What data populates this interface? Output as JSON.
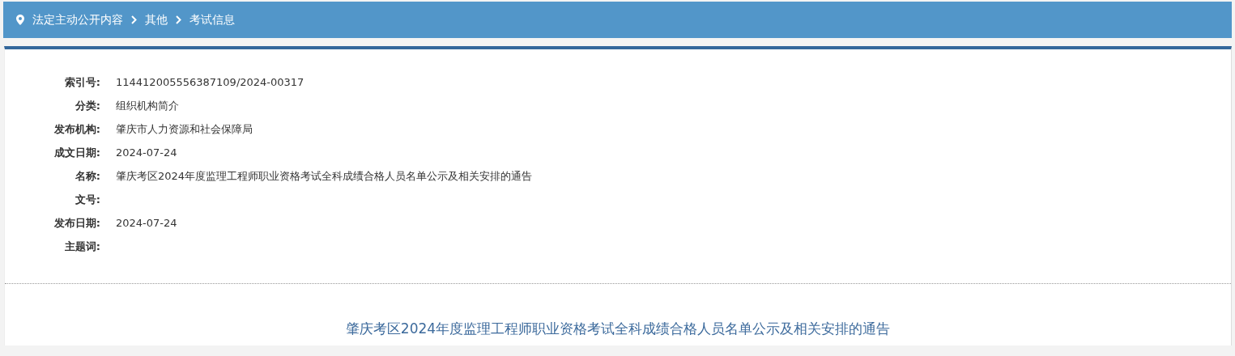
{
  "breadcrumb": [
    {
      "label": "法定主动公开内容"
    },
    {
      "label": "其他"
    },
    {
      "label": "考试信息"
    }
  ],
  "metadata": [
    {
      "label": "索引号:",
      "value": "114412005556387109/2024-00317"
    },
    {
      "label": "分类:",
      "value": "组织机构简介"
    },
    {
      "label": "发布机构:",
      "value": "肇庆市人力资源和社会保障局"
    },
    {
      "label": "成文日期:",
      "value": "2024-07-24"
    },
    {
      "label": "名称:",
      "value": "肇庆考区2024年度监理工程师职业资格考试全科成绩合格人员名单公示及相关安排的通告"
    },
    {
      "label": "文号:"
    },
    {
      "label": "发布日期:",
      "value": "2024-07-24"
    },
    {
      "label": "主题词:"
    }
  ],
  "article": {
    "title": "肇庆考区2024年度监理工程师职业资格考试全科成绩合格人员名单公示及相关安排的通告"
  }
}
